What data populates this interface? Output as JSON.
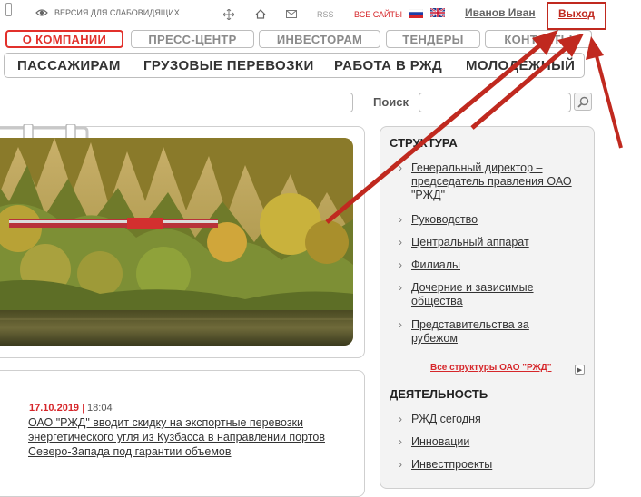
{
  "topbar": {
    "low_vision": "ВЕРСИЯ ДЛЯ СЛАБОВИДЯЩИХ",
    "rss": "RSS",
    "all_sites": "ВСЕ САЙТЫ",
    "user_name": "Иванов Иван",
    "logout": "Выход"
  },
  "nav_primary": [
    "О КОМПАНИИ",
    "ПРЕСС-ЦЕНТР",
    "ИНВЕСТОРАМ",
    "ТЕНДЕРЫ",
    "КОНТАКТЫ"
  ],
  "nav_secondary": [
    "ПАССАЖИРАМ",
    "ГРУЗОВЫЕ ПЕРЕВОЗКИ",
    "РАБОТА В РЖД",
    "МОЛОДЕЖНЫЙ"
  ],
  "search": {
    "label": "Поиск",
    "value": ""
  },
  "news": {
    "date": "17.10.2019",
    "separator": "|",
    "time": "18:04",
    "headline": "ОАО \"РЖД\" вводит скидку на экспортные перевозки энергетического угля из Кузбасса в направлении портов Северо-Запада под гарантии объемов"
  },
  "structure": {
    "title": "СТРУКТУРА",
    "items": [
      "Генеральный директор – председатель правления ОАО \"РЖД\"",
      "Руководство",
      "Центральный аппарат",
      "Филиалы",
      "Дочерние и зависимые общества",
      "Представительства за рубежом"
    ],
    "all_link": "Все структуры ОАО \"РЖД\""
  },
  "activity": {
    "title": "ДЕЯТЕЛЬНОСТЬ",
    "items": [
      "РЖД сегодня",
      "Инновации",
      "Инвестпроекты"
    ]
  },
  "colors": {
    "brand_red": "#e2302b",
    "annotation_red": "#c0291f"
  },
  "icons": [
    "phone-icon",
    "eye-icon",
    "sitemap-icon",
    "home-icon",
    "mail-icon",
    "flag-ru-icon",
    "flag-uk-icon",
    "magnifier-icon",
    "arrow-right-icon"
  ]
}
